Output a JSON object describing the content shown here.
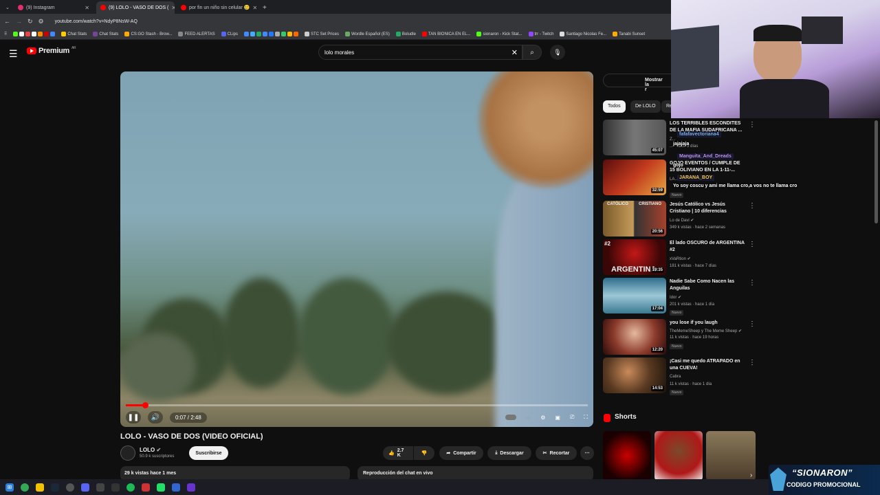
{
  "browser": {
    "tabs": [
      {
        "label": "(9) Instagram",
        "color": "#e1306c"
      },
      {
        "label": "(9) LOLO - VASO DE DOS (",
        "color": "#ff0000"
      },
      {
        "label": "por fin un niño sin celular 🥲",
        "color": "#ff0000"
      }
    ],
    "url": "youtube.com/watch?v=NdyP8NsW-AQ",
    "bookmarks": [
      "Chat Stats",
      "CS:GO Stash - Brow...",
      "FEED ALERTAS",
      "CLips",
      "STC Set Prices",
      "Wordle Español (ES)",
      "Boludle",
      "TAN BIONICA EN EL...",
      "sionaron - Kick Stat...",
      "trr - Twitch",
      "Santiago Nicolas Fe...",
      "Tanabi Sunset"
    ]
  },
  "youtube": {
    "logo_text": "Premium",
    "logo_region": "AR",
    "search_value": "lolo morales",
    "video": {
      "time": "0:07 / 2:48",
      "progress": 0.042,
      "title": "LOLO - VASO DE DOS (VIDEO OFICIAL)",
      "channel": "LOLO",
      "subscribers": "50.9 k suscriptores",
      "subscribe_label": "Suscribirse",
      "likes": "2.7 K",
      "share_label": "Compartir",
      "download_label": "Descargar",
      "clip_label": "Recortar",
      "views": "29 k vistas  hace 1 mes",
      "chat_replay": "Reproducción del chat en vivo"
    },
    "sidebar": {
      "show_more": "Mostrar la r",
      "chips": [
        "Todos",
        "De LOLO",
        "Re"
      ],
      "recs": [
        {
          "title": "LOS TERRIBLES ESCONDITES DE LA MAFIA SUDAFRICANA ...",
          "channel": "Z...",
          "meta": "... · hace 3 días",
          "badge": "",
          "duration": "45:07"
        },
        {
          "title": "GOJO EVENTOS / CUMPLE DE 15 BOLIVIANO EN LA 1-11-...",
          "channel": "LA...",
          "meta": "... ·",
          "badge": "Nuevo",
          "duration": "32:59"
        },
        {
          "title": "Jesús Católico vs Jesús Cristiano | 10 diferencias",
          "channel": "Lo de Davi",
          "meta": "349 k vistas · hace 2 semanas",
          "badge": "",
          "duration": "20:56"
        },
        {
          "title": "El lado OSCURO de ARGENTINA #2",
          "channel": "xVaRtion",
          "meta": "181 k vistas · hace 7 días",
          "badge": "",
          "duration": "19:35"
        },
        {
          "title": "Nadie Sabe Como Nacen las Anguilas",
          "channel": "Idor",
          "meta": "201 k vistas · hace 1 día",
          "badge": "Nuevo",
          "duration": "17:04"
        },
        {
          "title": "you lose if you laugh",
          "channel": "TheMemeSheep y The Meme Sheep",
          "meta": "11 k vistas · hace 19 horas",
          "badge": "Nuevo",
          "duration": "12:20"
        },
        {
          "title": "¡Casi me quedo ATRAPADO en una CUEVA!",
          "channel": "Cabra",
          "meta": "11 k vistas · hace 1 día",
          "badge": "Nuevo",
          "duration": "14:53"
        }
      ],
      "thumb_texts": {
        "catolico": "CATÓLICO",
        "cristiano": "CRISTIANO",
        "argentina": "ARGENTINA",
        "num2": "#2"
      },
      "shorts_label": "Shorts"
    }
  },
  "chat_overlay": [
    {
      "user": "fafafavectoriana4",
      "msg": ""
    },
    {
      "user": "",
      "msg": "jajajaja"
    },
    {
      "user": "Manguita_And_Dreads",
      "msg": ""
    },
    {
      "user": "",
      "msg": "gojo"
    },
    {
      "user": "JARANA_BOY",
      "msg": ""
    },
    {
      "user": "",
      "msg": "Yo soy coscu y ami me llama cro,a vos no te llama cro"
    }
  ],
  "promo": {
    "name": "“SIONARON”",
    "sub": "CODIGO PROMOCIONAL"
  },
  "colors": {
    "accent": "#ff0000",
    "bg": "#0f0f0f"
  }
}
